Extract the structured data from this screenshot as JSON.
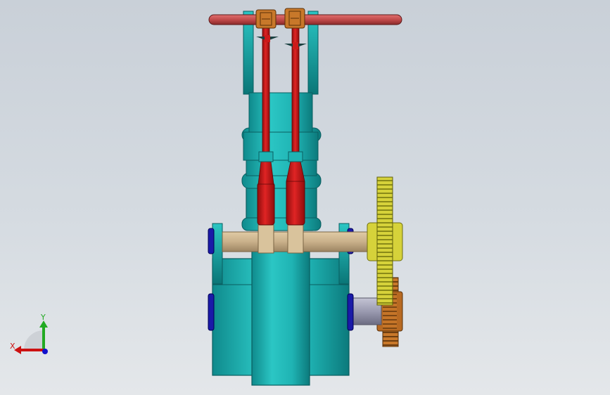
{
  "viewport": {
    "background_top": "#c9d0d8",
    "background_bottom": "#e4e7ea"
  },
  "model": {
    "colors": {
      "frame_cyan": "#1fb3b3",
      "frame_cyan_dark": "#0f8a8c",
      "rod_red": "#cc1a1a",
      "rod_red_dark": "#8f0d0d",
      "shaft_tan": "#c9b08a",
      "gear_yellow": "#d6d23a",
      "gear_orange": "#c8782a",
      "bearing_blue": "#1a1aa8",
      "shaft_gray": "#9a9ab0",
      "top_bar": "#c24a4a"
    },
    "parts": [
      "top-cross-bar",
      "upper-frame",
      "connecting-rod-left",
      "connecting-rod-right",
      "cylinder-block",
      "crankshaft",
      "crankcase",
      "spur-gear-large",
      "spur-gear-small"
    ]
  },
  "triad": {
    "x_label": "X",
    "y_label": "Y",
    "x_color": "#cc1111",
    "y_color": "#22aa22",
    "z_color": "#1111cc"
  }
}
